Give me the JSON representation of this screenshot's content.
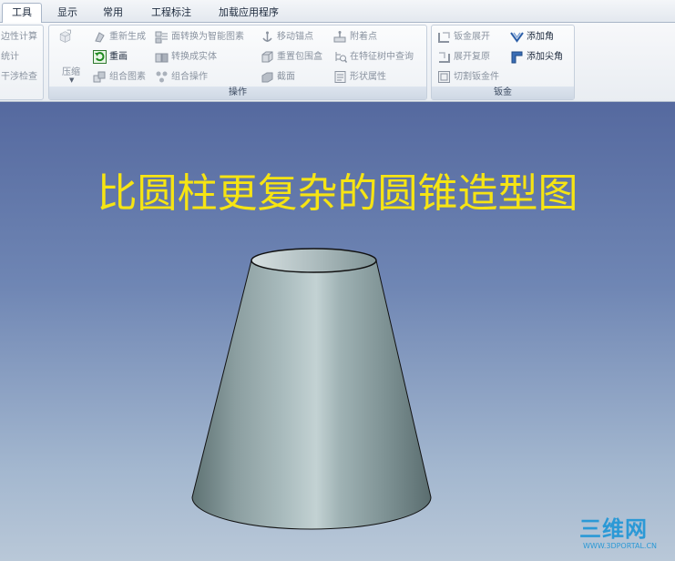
{
  "tabs": [
    {
      "label": "工具",
      "active": true
    },
    {
      "label": "显示",
      "active": false
    },
    {
      "label": "常用",
      "active": false
    },
    {
      "label": "工程标注",
      "active": false
    },
    {
      "label": "加载应用程序",
      "active": false
    }
  ],
  "ribbon": {
    "left_group": {
      "items": [
        "边性计算",
        "统计",
        "干涉检查"
      ]
    },
    "operations_group": {
      "label": "操作",
      "compress_label": "压缩",
      "items": {
        "regenerate": "重新生成",
        "redraw": "重画",
        "group_figure": "组合图素",
        "face_to_smart": "面转换为智能图素",
        "to_solid": "转换成实体",
        "group_op": "组合操作",
        "move_anchor": "移动锚点",
        "reset_bbox": "重置包围盒",
        "section": "截面",
        "attach_point": "附着点",
        "find_in_tree": "在特征树中查询",
        "shape_props": "形状属性"
      }
    },
    "sheetmetal_group": {
      "label": "钣金",
      "items": {
        "unfold": "钣金展开",
        "unfold_restore": "展开复原",
        "cut_sheet": "切割钣金件",
        "add_corner": "添加角",
        "add_sharp_corner": "添加尖角"
      }
    }
  },
  "viewport": {
    "title": "比圆柱更复杂的圆锥造型图",
    "watermark_main": "三维网",
    "watermark_sub": "WWW.3DPORTAL.CN"
  },
  "colors": {
    "title": "#f6e413",
    "watermark": "#2b99d6",
    "cone": "#8fa2a4"
  }
}
